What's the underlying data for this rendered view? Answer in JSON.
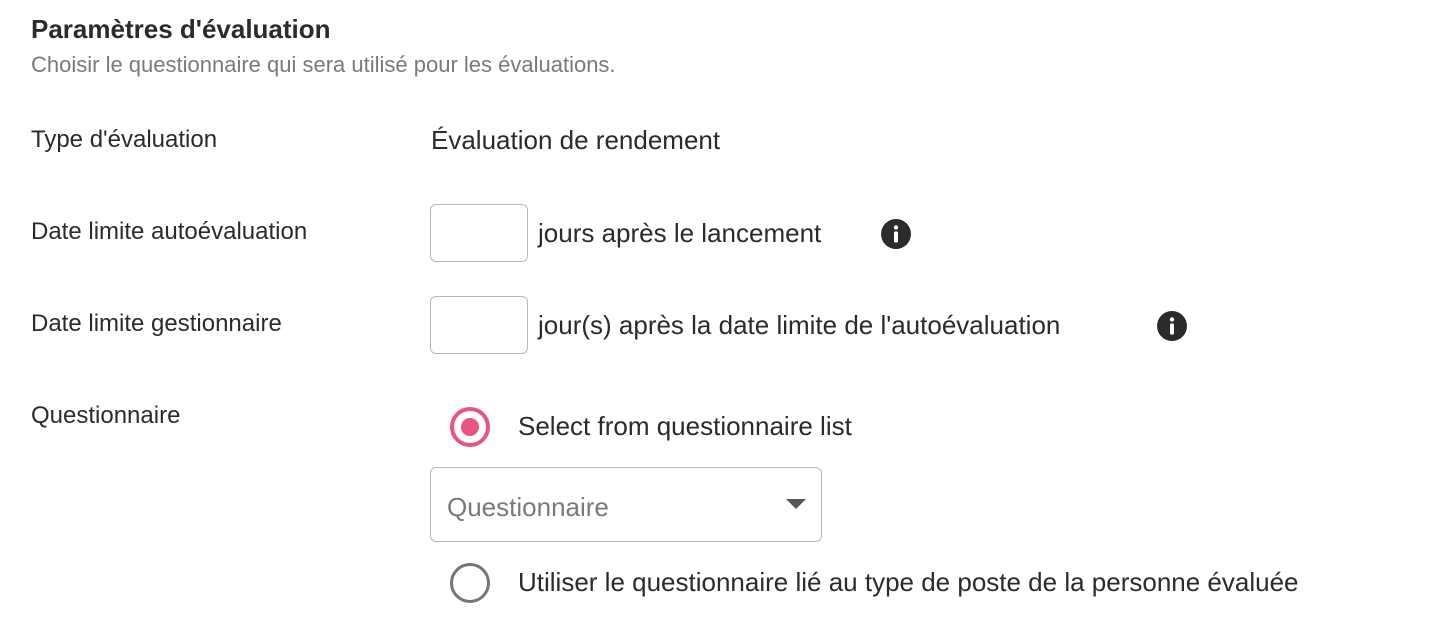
{
  "section": {
    "title": "Paramètres d'évaluation",
    "subtitle": "Choisir le questionnaire qui sera utilisé pour les évaluations."
  },
  "evaluation_type": {
    "label": "Type d'évaluation",
    "value": "Évaluation de rendement"
  },
  "self_deadline": {
    "label": "Date limite autoévaluation",
    "input_value": "",
    "suffix": "jours après le lancement",
    "info_icon": "info-icon"
  },
  "manager_deadline": {
    "label": "Date limite gestionnaire",
    "input_value": "",
    "suffix": "jour(s) après la date limite de l'autoévaluation",
    "info_icon": "info-icon"
  },
  "questionnaire": {
    "label": "Questionnaire",
    "options": [
      {
        "label": "Select from questionnaire list",
        "selected": true
      },
      {
        "label": "Utiliser le questionnaire lié au type de poste de la personne évaluée",
        "selected": false
      }
    ],
    "select": {
      "placeholder": "Questionnaire",
      "value": ""
    }
  },
  "colors": {
    "accent": "#e9557f",
    "text": "#2b2b2b",
    "muted": "#7a7a7a",
    "border": "#b8b8b8"
  }
}
